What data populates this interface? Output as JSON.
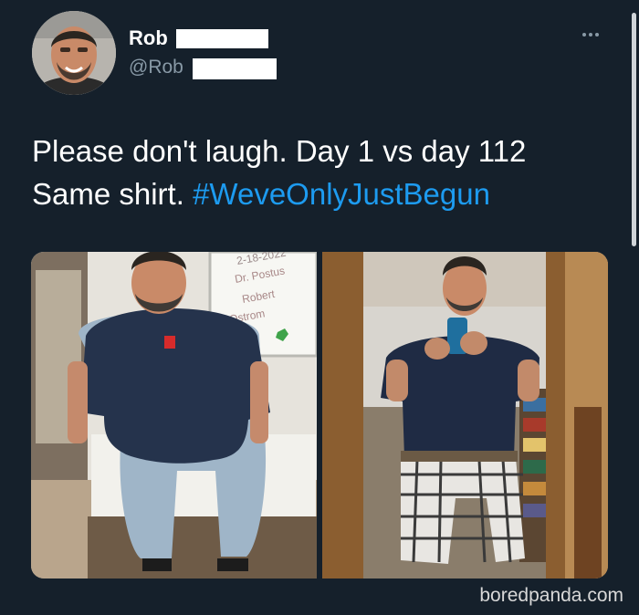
{
  "tweet": {
    "display_name": "Rob",
    "handle": "@Rob",
    "text": "Please don't laugh. Day 1 vs day 112 Same shirt.",
    "hashtag": "#WeveOnlyJustBegun",
    "whiteboard_text": [
      "2-18-2022",
      "Dr. Postus",
      "Robert",
      "Ostrom"
    ]
  },
  "watermark": "boredpanda.com"
}
